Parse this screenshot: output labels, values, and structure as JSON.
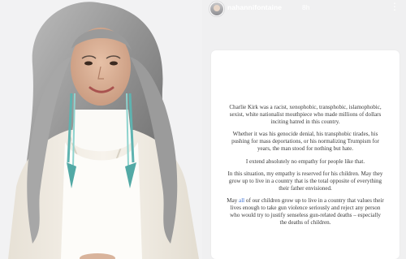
{
  "story": {
    "username": "nahannifontaine",
    "time": "8h",
    "menu_icon": "more-vertical-icon",
    "paragraphs": [
      "Charlie Kirk was a racist, xenophobic, transphobic, islamophobic, sexist, white nationalist mouthpiece who made millions of dollars inciting hatred in this country.",
      "Whether it was his genocide denial, his transphobic tirades, his pushing for mass deportations, or his normalizing Trumpism for years, the man stood for nothing but hate.",
      "I extend absolutely no empathy for people like that.",
      "In this situation, my empathy is reserved for his children. May they grow up to live in a country that is the total opposite of everything their father envisioned."
    ],
    "last_paragraph": {
      "before": "May ",
      "highlight": "all",
      "after": " of our children grow up to live in a country that values their lives enough to take gun violence seriously and reject any person who would try to justify senseless gun-related deaths – especially the deaths of children."
    }
  },
  "colors": {
    "photo_background": "#f2f2f3",
    "story_background": "#f0f0f1",
    "card": "#ffffff",
    "text": "#3a3a3a",
    "highlight": "#3c6fd1"
  }
}
